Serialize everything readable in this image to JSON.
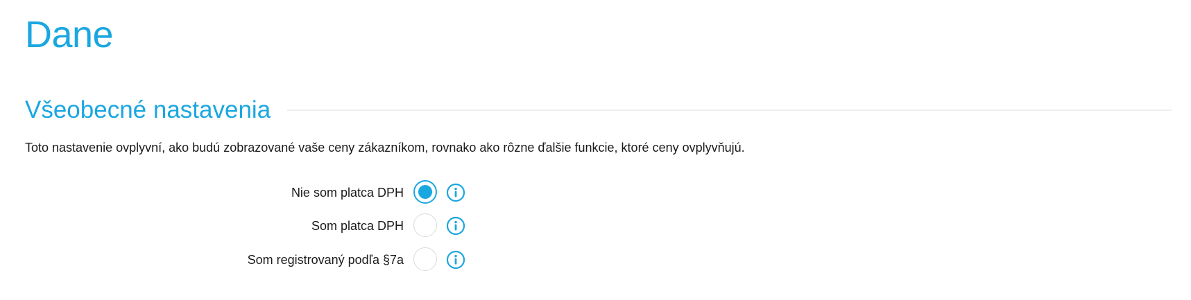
{
  "colors": {
    "accent": "#1aa7e0",
    "text": "#1a1a1a",
    "radio_border": "#d7dadd",
    "divider": "#eceef0"
  },
  "page": {
    "title": "Dane"
  },
  "section": {
    "title": "Všeobecné nastavenia",
    "description": "Toto nastavenie ovplyvní, ako budú zobrazované vaše ceny zákazníkom, rovnako ako rôzne ďalšie funkcie, ktoré ceny ovplyvňujú."
  },
  "options": [
    {
      "label": "Nie som platca DPH",
      "selected": true,
      "icon": "info-icon"
    },
    {
      "label": "Som platca DPH",
      "selected": false,
      "icon": "info-icon"
    },
    {
      "label": "Som registrovaný podľa §7a",
      "selected": false,
      "icon": "info-icon"
    }
  ]
}
